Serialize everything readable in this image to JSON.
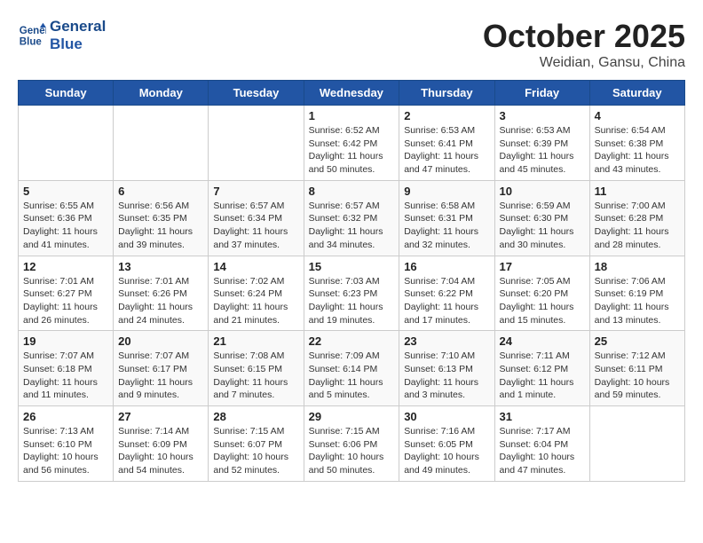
{
  "header": {
    "logo_line1": "General",
    "logo_line2": "Blue",
    "month": "October 2025",
    "location": "Weidian, Gansu, China"
  },
  "weekdays": [
    "Sunday",
    "Monday",
    "Tuesday",
    "Wednesday",
    "Thursday",
    "Friday",
    "Saturday"
  ],
  "weeks": [
    [
      {
        "day": "",
        "info": ""
      },
      {
        "day": "",
        "info": ""
      },
      {
        "day": "",
        "info": ""
      },
      {
        "day": "1",
        "info": "Sunrise: 6:52 AM\nSunset: 6:42 PM\nDaylight: 11 hours\nand 50 minutes."
      },
      {
        "day": "2",
        "info": "Sunrise: 6:53 AM\nSunset: 6:41 PM\nDaylight: 11 hours\nand 47 minutes."
      },
      {
        "day": "3",
        "info": "Sunrise: 6:53 AM\nSunset: 6:39 PM\nDaylight: 11 hours\nand 45 minutes."
      },
      {
        "day": "4",
        "info": "Sunrise: 6:54 AM\nSunset: 6:38 PM\nDaylight: 11 hours\nand 43 minutes."
      }
    ],
    [
      {
        "day": "5",
        "info": "Sunrise: 6:55 AM\nSunset: 6:36 PM\nDaylight: 11 hours\nand 41 minutes."
      },
      {
        "day": "6",
        "info": "Sunrise: 6:56 AM\nSunset: 6:35 PM\nDaylight: 11 hours\nand 39 minutes."
      },
      {
        "day": "7",
        "info": "Sunrise: 6:57 AM\nSunset: 6:34 PM\nDaylight: 11 hours\nand 37 minutes."
      },
      {
        "day": "8",
        "info": "Sunrise: 6:57 AM\nSunset: 6:32 PM\nDaylight: 11 hours\nand 34 minutes."
      },
      {
        "day": "9",
        "info": "Sunrise: 6:58 AM\nSunset: 6:31 PM\nDaylight: 11 hours\nand 32 minutes."
      },
      {
        "day": "10",
        "info": "Sunrise: 6:59 AM\nSunset: 6:30 PM\nDaylight: 11 hours\nand 30 minutes."
      },
      {
        "day": "11",
        "info": "Sunrise: 7:00 AM\nSunset: 6:28 PM\nDaylight: 11 hours\nand 28 minutes."
      }
    ],
    [
      {
        "day": "12",
        "info": "Sunrise: 7:01 AM\nSunset: 6:27 PM\nDaylight: 11 hours\nand 26 minutes."
      },
      {
        "day": "13",
        "info": "Sunrise: 7:01 AM\nSunset: 6:26 PM\nDaylight: 11 hours\nand 24 minutes."
      },
      {
        "day": "14",
        "info": "Sunrise: 7:02 AM\nSunset: 6:24 PM\nDaylight: 11 hours\nand 21 minutes."
      },
      {
        "day": "15",
        "info": "Sunrise: 7:03 AM\nSunset: 6:23 PM\nDaylight: 11 hours\nand 19 minutes."
      },
      {
        "day": "16",
        "info": "Sunrise: 7:04 AM\nSunset: 6:22 PM\nDaylight: 11 hours\nand 17 minutes."
      },
      {
        "day": "17",
        "info": "Sunrise: 7:05 AM\nSunset: 6:20 PM\nDaylight: 11 hours\nand 15 minutes."
      },
      {
        "day": "18",
        "info": "Sunrise: 7:06 AM\nSunset: 6:19 PM\nDaylight: 11 hours\nand 13 minutes."
      }
    ],
    [
      {
        "day": "19",
        "info": "Sunrise: 7:07 AM\nSunset: 6:18 PM\nDaylight: 11 hours\nand 11 minutes."
      },
      {
        "day": "20",
        "info": "Sunrise: 7:07 AM\nSunset: 6:17 PM\nDaylight: 11 hours\nand 9 minutes."
      },
      {
        "day": "21",
        "info": "Sunrise: 7:08 AM\nSunset: 6:15 PM\nDaylight: 11 hours\nand 7 minutes."
      },
      {
        "day": "22",
        "info": "Sunrise: 7:09 AM\nSunset: 6:14 PM\nDaylight: 11 hours\nand 5 minutes."
      },
      {
        "day": "23",
        "info": "Sunrise: 7:10 AM\nSunset: 6:13 PM\nDaylight: 11 hours\nand 3 minutes."
      },
      {
        "day": "24",
        "info": "Sunrise: 7:11 AM\nSunset: 6:12 PM\nDaylight: 11 hours\nand 1 minute."
      },
      {
        "day": "25",
        "info": "Sunrise: 7:12 AM\nSunset: 6:11 PM\nDaylight: 10 hours\nand 59 minutes."
      }
    ],
    [
      {
        "day": "26",
        "info": "Sunrise: 7:13 AM\nSunset: 6:10 PM\nDaylight: 10 hours\nand 56 minutes."
      },
      {
        "day": "27",
        "info": "Sunrise: 7:14 AM\nSunset: 6:09 PM\nDaylight: 10 hours\nand 54 minutes."
      },
      {
        "day": "28",
        "info": "Sunrise: 7:15 AM\nSunset: 6:07 PM\nDaylight: 10 hours\nand 52 minutes."
      },
      {
        "day": "29",
        "info": "Sunrise: 7:15 AM\nSunset: 6:06 PM\nDaylight: 10 hours\nand 50 minutes."
      },
      {
        "day": "30",
        "info": "Sunrise: 7:16 AM\nSunset: 6:05 PM\nDaylight: 10 hours\nand 49 minutes."
      },
      {
        "day": "31",
        "info": "Sunrise: 7:17 AM\nSunset: 6:04 PM\nDaylight: 10 hours\nand 47 minutes."
      },
      {
        "day": "",
        "info": ""
      }
    ]
  ]
}
